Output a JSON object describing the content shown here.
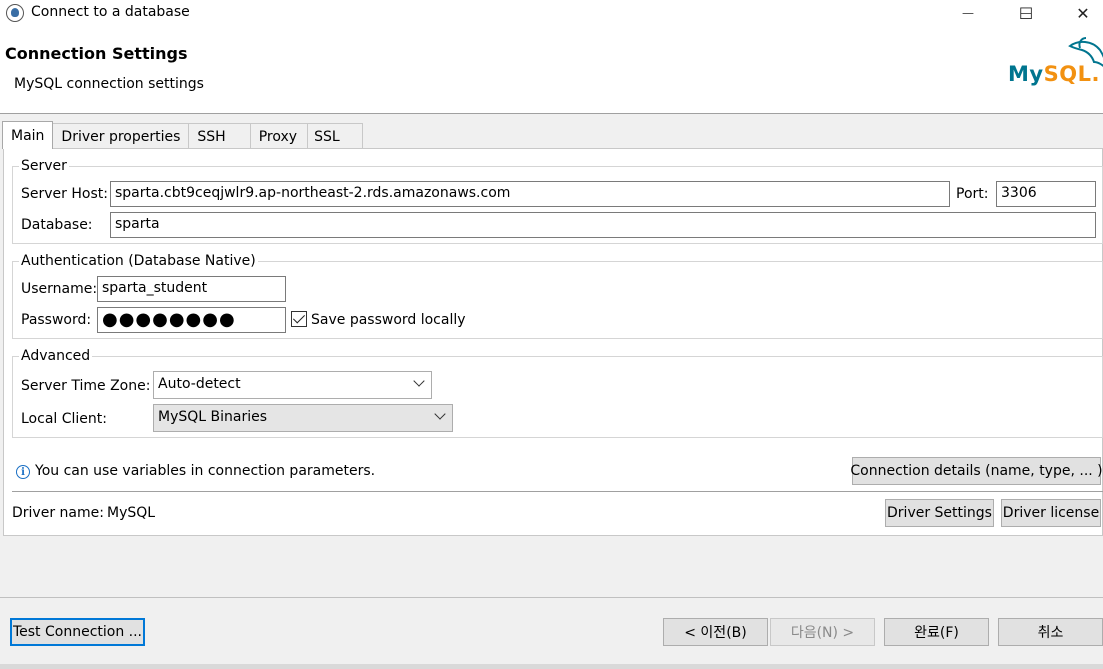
{
  "window": {
    "title": "Connect to a database",
    "minimize_glyph": "—",
    "maximize_glyph": "☐",
    "close_glyph": "✕"
  },
  "header": {
    "title": "Connection Settings",
    "subtitle": "MySQL connection settings",
    "logo_text_my": "My",
    "logo_text_sql": "SQL."
  },
  "tabs": [
    {
      "label": "Main",
      "active": true
    },
    {
      "label": "Driver properties"
    },
    {
      "label": "SSH"
    },
    {
      "label": "Proxy"
    },
    {
      "label": "SSL"
    }
  ],
  "server": {
    "legend": "Server",
    "host_label": "Server Host:",
    "host_value": "sparta.cbt9ceqjwlr9.ap-northeast-2.rds.amazonaws.com",
    "port_label": "Port:",
    "port_value": "3306",
    "database_label": "Database:",
    "database_value": "sparta"
  },
  "auth": {
    "legend": "Authentication (Database Native)",
    "username_label": "Username:",
    "username_value": "sparta_student",
    "password_label": "Password:",
    "password_mask": "●●●●●●●●",
    "save_password_label": "Save password locally",
    "save_password_checked": true
  },
  "advanced": {
    "legend": "Advanced",
    "timezone_label": "Server Time Zone:",
    "timezone_value": "Auto-detect",
    "client_label": "Local Client:",
    "client_value": "MySQL Binaries"
  },
  "info": {
    "text": "You can use variables in connection parameters.",
    "details_button": "Connection details (name, type, ... )"
  },
  "driver": {
    "label": "Driver name:",
    "value": "MySQL",
    "settings_button": "Driver Settings",
    "license_button": "Driver license"
  },
  "footer": {
    "test_button": "Test Connection ...",
    "back_button": "< 이전(B)",
    "next_button": "다음(N) >",
    "finish_button": "완료(F)",
    "cancel_button": "취소"
  },
  "colors": {
    "mysql_blue": "#00758f",
    "mysql_orange": "#f29111",
    "focus_blue": "#0078d7"
  }
}
